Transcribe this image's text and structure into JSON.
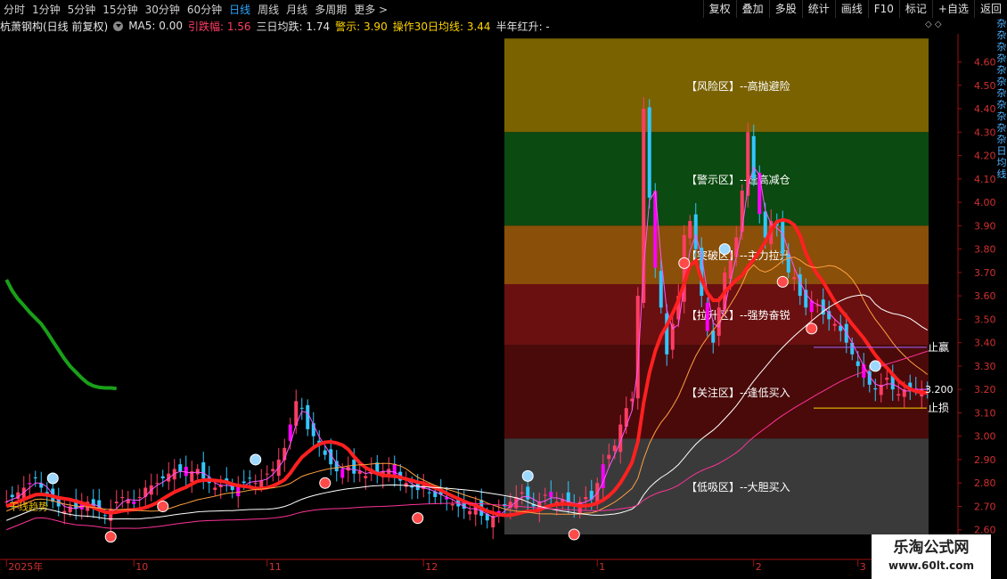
{
  "toolbar": {
    "periods": [
      "分时",
      "1分钟",
      "5分钟",
      "15分钟",
      "30分钟",
      "60分钟",
      "日线",
      "周线",
      "月线",
      "多周期",
      "更多 >"
    ],
    "active_period": "日线",
    "right_tools": [
      "复权",
      "叠加",
      "多股",
      "统计",
      "画线",
      "F10",
      "标记",
      "+自选",
      "返回"
    ]
  },
  "info": {
    "stock": "杭萧钢构(日线 前复权)",
    "ma5": "MA5: 0.00",
    "yindiefu": "引跌幅: 1.56",
    "sanri": "三日均跌: 1.74",
    "jingshi": "警示: 3.90",
    "caozuo": "操作30日均线: 3.44",
    "bannian": "半年红升: -"
  },
  "zones": [
    {
      "label": "【风险区】--高抛避险",
      "from": 4.3,
      "to": 4.7,
      "color": "#7a6200"
    },
    {
      "label": "【警示区】--逢高减仓",
      "from": 3.9,
      "to": 4.3,
      "color": "#0b4a10"
    },
    {
      "label": "【突破区】--主力拉升",
      "from": 3.65,
      "to": 3.9,
      "color": "#8a4f08"
    },
    {
      "label": "【拉升区】--强势奋锐",
      "from": 3.39,
      "to": 3.65,
      "color": "#6a1010"
    },
    {
      "label": "【关注区】--逢低买入",
      "from": 2.99,
      "to": 3.39,
      "color": "#4a0a0a"
    },
    {
      "label": "【低吸区】--大胆买入",
      "from": 2.58,
      "to": 2.99,
      "color": "#3a3a3a"
    }
  ],
  "price_axis": {
    "min": 2.58,
    "max": 4.72,
    "ticks": [
      "4.60",
      "4.50",
      "4.40",
      "4.30",
      "4.20",
      "4.10",
      "4.00",
      "3.90",
      "3.80",
      "3.70",
      "3.60",
      "3.50",
      "3.40",
      "3.30",
      "3.20",
      "3.10",
      "3.00",
      "2.90",
      "2.80",
      "2.70",
      "2.60"
    ]
  },
  "date_axis": [
    {
      "label": "2025年",
      "index": 0
    },
    {
      "label": "10",
      "index": 22
    },
    {
      "label": "11",
      "index": 45
    },
    {
      "label": "12",
      "index": 72
    },
    {
      "label": "1",
      "index": 102
    },
    {
      "label": "2",
      "index": 129
    },
    {
      "label": "3",
      "index": 147
    }
  ],
  "annotations": {
    "zhiying": "止赢",
    "zhisun": "止损",
    "price_tag": "3.200",
    "left_label": "干线趋势"
  },
  "colors": {
    "up": "#ff3d64",
    "down": "#33c6ff",
    "magenta": "#ff00ff"
  },
  "watermark": {
    "line1": "乐淘公式网",
    "line2": "www.60lt.com"
  },
  "side_text": "杂杂杂杂杂杂杂杂杂杂杂日均线"
}
